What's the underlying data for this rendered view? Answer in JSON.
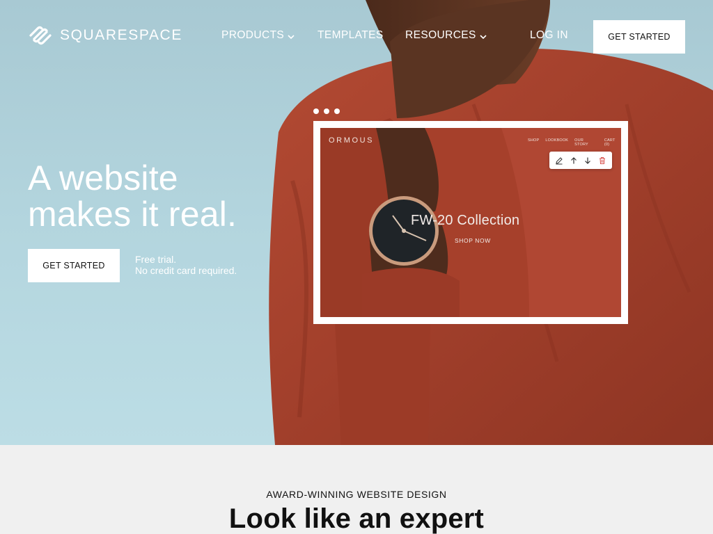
{
  "brand": {
    "name": "SQUARESPACE"
  },
  "nav": {
    "items": [
      {
        "label": "PRODUCTS",
        "has_dropdown": true
      },
      {
        "label": "TEMPLATES",
        "has_dropdown": false
      },
      {
        "label": "RESOURCES",
        "has_dropdown": true
      },
      {
        "label": "LOG IN",
        "has_dropdown": false
      }
    ],
    "cta_label": "GET STARTED"
  },
  "hero": {
    "headline_line1": "A website",
    "headline_line2": "makes it real.",
    "cta_label": "GET STARTED",
    "trial_line1": "Free trial.",
    "trial_line2": "No credit card required."
  },
  "preview": {
    "slide_count": 3,
    "site_brand": "ORMOUS",
    "site_nav": [
      "SHOP",
      "LOOKBOOK",
      "OUR STORY",
      "CART (0)"
    ],
    "toolbar_icons": [
      "pencil-icon",
      "arrow-up-icon",
      "arrow-down-icon",
      "trash-icon"
    ],
    "collection_title": "FW-20 Collection",
    "shop_now": "SHOP NOW"
  },
  "section": {
    "eyebrow": "AWARD-WINNING WEBSITE DESIGN",
    "title": "Look like an expert"
  },
  "colors": {
    "sky": "#a8c9d3",
    "garment": "#a9412c",
    "skin": "#5a3422",
    "white": "#ffffff",
    "text_dark": "#111111",
    "section_bg": "#f0f0f0",
    "trash_red": "#d9534f"
  }
}
